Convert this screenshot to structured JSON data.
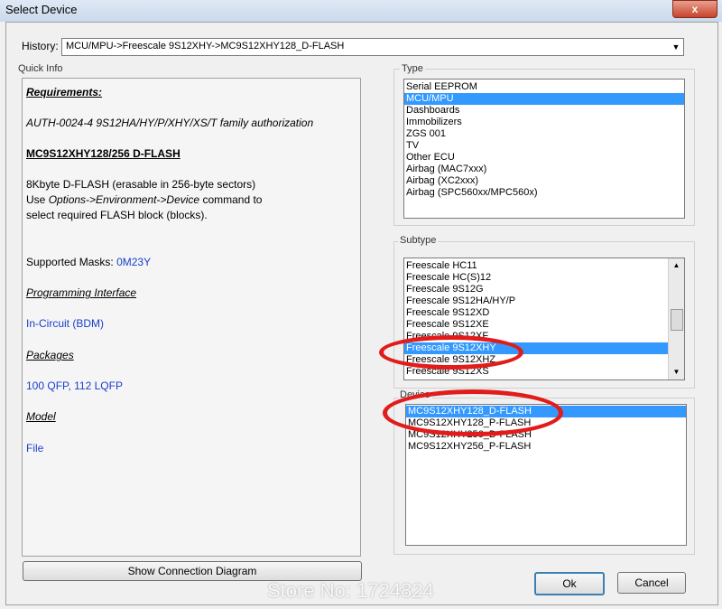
{
  "window": {
    "title": "Select Device",
    "close_glyph": "x"
  },
  "history": {
    "label": "History:",
    "value": "MCU/MPU->Freescale 9S12XHY->MC9S12XHY128_D-FLASH",
    "dropdown_icon": "chevron-down-icon"
  },
  "quick_info": {
    "label": "Quick Info",
    "requirements_heading": "Requirements:",
    "auth": "AUTH-0024-4  9S12HA/HY/P/XHY/XS/T family authorization",
    "device_heading": "MC9S12XHY128/256 D-FLASH",
    "desc1": "8Kbyte D-FLASH (erasable in 256-byte sectors)",
    "desc2_pre": "Use ",
    "desc2_link": "Options->Environment->Device",
    "desc2_post": " command to",
    "desc3": "select required FLASH block (blocks).",
    "masks_label": "Supported Masks: ",
    "masks_value": "0M23Y",
    "prog_heading": "Programming Interface",
    "prog_value": "In-Circuit (BDM)",
    "packages_heading": "Packages",
    "packages_value": "100 QFP, 112 LQFP",
    "model_heading": "Model",
    "model_value": "File"
  },
  "type": {
    "label": "Type",
    "items": [
      "Serial EEPROM",
      "MCU/MPU",
      "Dashboards",
      "Immobilizers",
      "ZGS 001",
      "TV",
      "Other ECU",
      "Airbag (MAC7xxx)",
      "Airbag (XC2xxx)",
      "Airbag (SPC560xx/MPC560x)"
    ],
    "selected": 1
  },
  "subtype": {
    "label": "Subtype",
    "items": [
      "Freescale HC11",
      "Freescale HC(S)12",
      "Freescale 9S12G",
      "Freescale 9S12HA/HY/P",
      "Freescale 9S12XD",
      "Freescale 9S12XE",
      "Freescale 9S12XF",
      "Freescale 9S12XHY",
      "Freescale 9S12XHZ",
      "Freescale 9S12XS"
    ],
    "selected": 7,
    "scroll_up": "▲",
    "scroll_down": "▼"
  },
  "device": {
    "label": "Device",
    "items": [
      "MC9S12XHY128_D-FLASH",
      "MC9S12XHY128_P-FLASH",
      "MC9S12XHY256_D-FLASH",
      "MC9S12XHY256_P-FLASH"
    ],
    "selected": 0
  },
  "buttons": {
    "diagram": "Show Connection Diagram",
    "ok": "Ok",
    "cancel": "Cancel"
  },
  "watermark": "Store No: 1724824",
  "colors": {
    "selection": "#3399ff",
    "annotation": "#e21b1b",
    "link": "#1a3ecc"
  }
}
